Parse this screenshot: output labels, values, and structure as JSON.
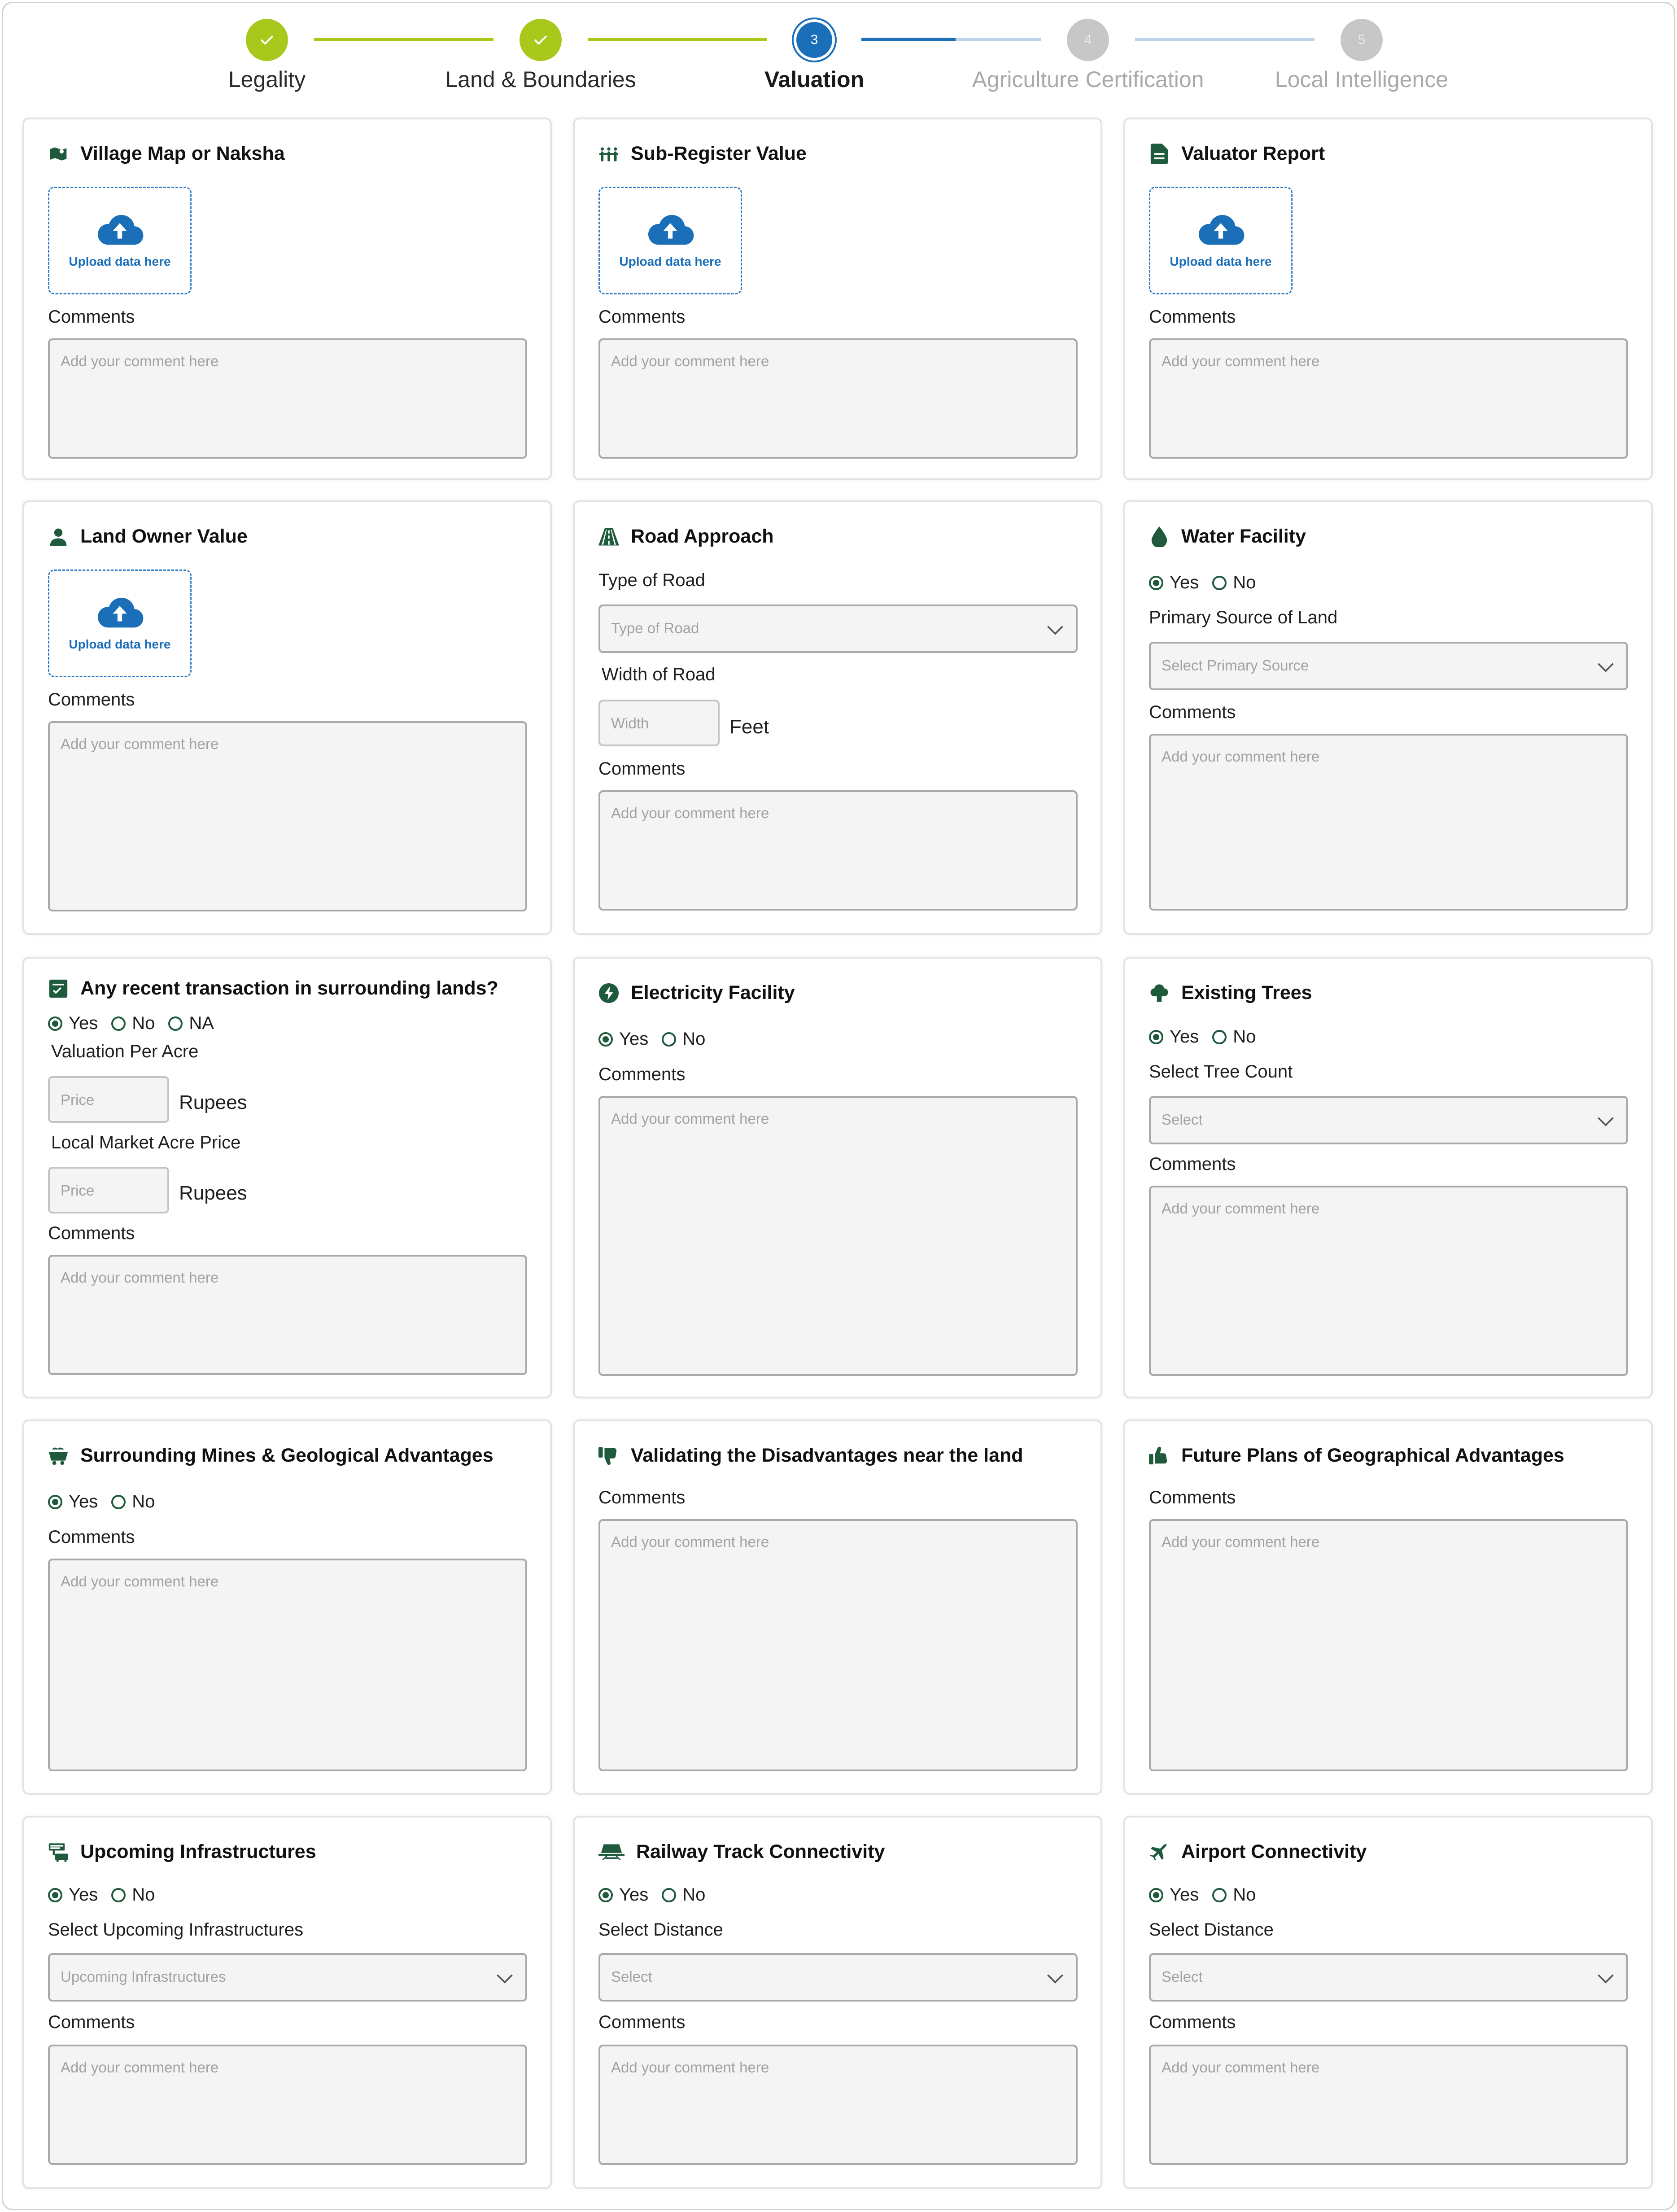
{
  "colors": {
    "brand_green": "#1f5a3d",
    "done": "#a8c81c",
    "active": "#1a6fb8",
    "pending": "#c7c7c7"
  },
  "stepper": {
    "steps": [
      {
        "label": "Legality",
        "state": "done"
      },
      {
        "label": "Land & Boundaries",
        "state": "done"
      },
      {
        "label": "Valuation",
        "number": "3",
        "state": "active"
      },
      {
        "label": "Agriculture Certification",
        "number": "4",
        "state": "pending"
      },
      {
        "label": "Local Intelligence",
        "number": "5",
        "state": "pending"
      }
    ]
  },
  "common": {
    "upload_label": "Upload data here",
    "comments_label": "Comments",
    "comment_placeholder": "Add your comment here",
    "yes": "Yes",
    "no": "No",
    "na": "NA"
  },
  "cards": {
    "village_map": {
      "title": "Village Map or Naksha",
      "icon": "map-icon"
    },
    "sub_register": {
      "title": "Sub-Register Value",
      "icon": "people-group-icon"
    },
    "valuator_report": {
      "title": "Valuator Report",
      "icon": "document-icon"
    },
    "land_owner": {
      "title": "Land Owner Value",
      "icon": "person-icon"
    },
    "road_approach": {
      "title": "Road Approach",
      "icon": "road-icon",
      "type_label": "Type of Road",
      "type_placeholder": "Type of Road",
      "width_label": "Width of Road",
      "width_placeholder": "Width",
      "width_unit": "Feet"
    },
    "water_facility": {
      "title": "Water Facility",
      "icon": "water-drop-icon",
      "selected": "Yes",
      "source_label": "Primary Source of Land",
      "source_placeholder": "Select Primary Source"
    },
    "recent_transaction": {
      "title": "Any recent transaction in surrounding lands?",
      "icon": "checklist-icon",
      "selected": "Yes",
      "valuation_label": "Valuation Per Acre",
      "price_placeholder": "Price",
      "unit": "Rupees",
      "market_label": "Local Market Acre Price"
    },
    "electricity": {
      "title": "Electricity Facility",
      "icon": "lightning-icon",
      "selected": "Yes"
    },
    "trees": {
      "title": "Existing Trees",
      "icon": "tree-icon",
      "selected": "Yes",
      "count_label": "Select Tree Count",
      "count_placeholder": "Select"
    },
    "mines": {
      "title": "Surrounding Mines & Geological Advantages",
      "icon": "mine-cart-icon",
      "selected": "Yes"
    },
    "disadvantages": {
      "title": "Validating the Disadvantages near the land",
      "icon": "thumbs-down-icon"
    },
    "future_plans": {
      "title": "Future Plans of Geographical Advantages",
      "icon": "thumbs-up-icon"
    },
    "infrastructure": {
      "title": "Upcoming Infrastructures",
      "icon": "construction-icon",
      "selected": "Yes",
      "select_label": "Select Upcoming Infrastructures",
      "select_placeholder": "Upcoming Infrastructures"
    },
    "railway": {
      "title": "Railway Track Connectivity",
      "icon": "train-icon",
      "selected": "Yes",
      "select_label": "Select Distance",
      "select_placeholder": "Select"
    },
    "airport": {
      "title": "Airport Connectivity",
      "icon": "airplane-icon",
      "selected": "Yes",
      "select_label": "Select Distance",
      "select_placeholder": "Select"
    }
  }
}
